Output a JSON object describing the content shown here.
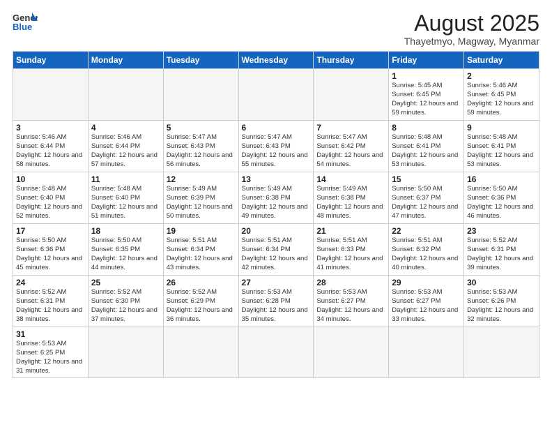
{
  "logo": {
    "text_general": "General",
    "text_blue": "Blue"
  },
  "calendar": {
    "title": "August 2025",
    "subtitle": "Thayetmyo, Magway, Myanmar",
    "days_of_week": [
      "Sunday",
      "Monday",
      "Tuesday",
      "Wednesday",
      "Thursday",
      "Friday",
      "Saturday"
    ],
    "weeks": [
      [
        {
          "num": "",
          "detail": ""
        },
        {
          "num": "",
          "detail": ""
        },
        {
          "num": "",
          "detail": ""
        },
        {
          "num": "",
          "detail": ""
        },
        {
          "num": "",
          "detail": ""
        },
        {
          "num": "1",
          "detail": "Sunrise: 5:45 AM\nSunset: 6:45 PM\nDaylight: 12 hours\nand 59 minutes."
        },
        {
          "num": "2",
          "detail": "Sunrise: 5:46 AM\nSunset: 6:45 PM\nDaylight: 12 hours\nand 59 minutes."
        }
      ],
      [
        {
          "num": "3",
          "detail": "Sunrise: 5:46 AM\nSunset: 6:44 PM\nDaylight: 12 hours\nand 58 minutes."
        },
        {
          "num": "4",
          "detail": "Sunrise: 5:46 AM\nSunset: 6:44 PM\nDaylight: 12 hours\nand 57 minutes."
        },
        {
          "num": "5",
          "detail": "Sunrise: 5:47 AM\nSunset: 6:43 PM\nDaylight: 12 hours\nand 56 minutes."
        },
        {
          "num": "6",
          "detail": "Sunrise: 5:47 AM\nSunset: 6:43 PM\nDaylight: 12 hours\nand 55 minutes."
        },
        {
          "num": "7",
          "detail": "Sunrise: 5:47 AM\nSunset: 6:42 PM\nDaylight: 12 hours\nand 54 minutes."
        },
        {
          "num": "8",
          "detail": "Sunrise: 5:48 AM\nSunset: 6:41 PM\nDaylight: 12 hours\nand 53 minutes."
        },
        {
          "num": "9",
          "detail": "Sunrise: 5:48 AM\nSunset: 6:41 PM\nDaylight: 12 hours\nand 53 minutes."
        }
      ],
      [
        {
          "num": "10",
          "detail": "Sunrise: 5:48 AM\nSunset: 6:40 PM\nDaylight: 12 hours\nand 52 minutes."
        },
        {
          "num": "11",
          "detail": "Sunrise: 5:48 AM\nSunset: 6:40 PM\nDaylight: 12 hours\nand 51 minutes."
        },
        {
          "num": "12",
          "detail": "Sunrise: 5:49 AM\nSunset: 6:39 PM\nDaylight: 12 hours\nand 50 minutes."
        },
        {
          "num": "13",
          "detail": "Sunrise: 5:49 AM\nSunset: 6:38 PM\nDaylight: 12 hours\nand 49 minutes."
        },
        {
          "num": "14",
          "detail": "Sunrise: 5:49 AM\nSunset: 6:38 PM\nDaylight: 12 hours\nand 48 minutes."
        },
        {
          "num": "15",
          "detail": "Sunrise: 5:50 AM\nSunset: 6:37 PM\nDaylight: 12 hours\nand 47 minutes."
        },
        {
          "num": "16",
          "detail": "Sunrise: 5:50 AM\nSunset: 6:36 PM\nDaylight: 12 hours\nand 46 minutes."
        }
      ],
      [
        {
          "num": "17",
          "detail": "Sunrise: 5:50 AM\nSunset: 6:36 PM\nDaylight: 12 hours\nand 45 minutes."
        },
        {
          "num": "18",
          "detail": "Sunrise: 5:50 AM\nSunset: 6:35 PM\nDaylight: 12 hours\nand 44 minutes."
        },
        {
          "num": "19",
          "detail": "Sunrise: 5:51 AM\nSunset: 6:34 PM\nDaylight: 12 hours\nand 43 minutes."
        },
        {
          "num": "20",
          "detail": "Sunrise: 5:51 AM\nSunset: 6:34 PM\nDaylight: 12 hours\nand 42 minutes."
        },
        {
          "num": "21",
          "detail": "Sunrise: 5:51 AM\nSunset: 6:33 PM\nDaylight: 12 hours\nand 41 minutes."
        },
        {
          "num": "22",
          "detail": "Sunrise: 5:51 AM\nSunset: 6:32 PM\nDaylight: 12 hours\nand 40 minutes."
        },
        {
          "num": "23",
          "detail": "Sunrise: 5:52 AM\nSunset: 6:31 PM\nDaylight: 12 hours\nand 39 minutes."
        }
      ],
      [
        {
          "num": "24",
          "detail": "Sunrise: 5:52 AM\nSunset: 6:31 PM\nDaylight: 12 hours\nand 38 minutes."
        },
        {
          "num": "25",
          "detail": "Sunrise: 5:52 AM\nSunset: 6:30 PM\nDaylight: 12 hours\nand 37 minutes."
        },
        {
          "num": "26",
          "detail": "Sunrise: 5:52 AM\nSunset: 6:29 PM\nDaylight: 12 hours\nand 36 minutes."
        },
        {
          "num": "27",
          "detail": "Sunrise: 5:53 AM\nSunset: 6:28 PM\nDaylight: 12 hours\nand 35 minutes."
        },
        {
          "num": "28",
          "detail": "Sunrise: 5:53 AM\nSunset: 6:27 PM\nDaylight: 12 hours\nand 34 minutes."
        },
        {
          "num": "29",
          "detail": "Sunrise: 5:53 AM\nSunset: 6:27 PM\nDaylight: 12 hours\nand 33 minutes."
        },
        {
          "num": "30",
          "detail": "Sunrise: 5:53 AM\nSunset: 6:26 PM\nDaylight: 12 hours\nand 32 minutes."
        }
      ],
      [
        {
          "num": "31",
          "detail": "Sunrise: 5:53 AM\nSunset: 6:25 PM\nDaylight: 12 hours\nand 31 minutes."
        },
        {
          "num": "",
          "detail": ""
        },
        {
          "num": "",
          "detail": ""
        },
        {
          "num": "",
          "detail": ""
        },
        {
          "num": "",
          "detail": ""
        },
        {
          "num": "",
          "detail": ""
        },
        {
          "num": "",
          "detail": ""
        }
      ]
    ]
  }
}
